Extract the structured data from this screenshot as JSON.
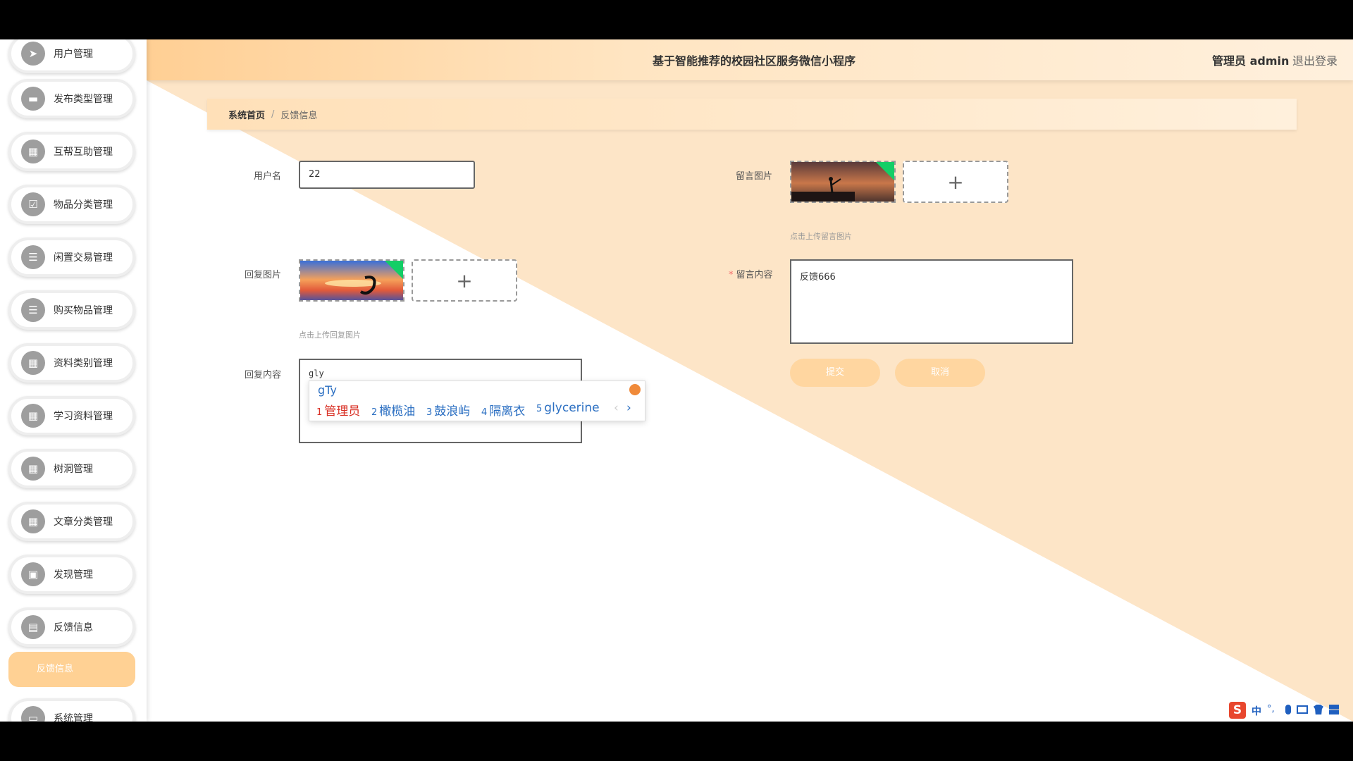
{
  "header": {
    "app_title": "基于智能推荐的校园社区服务微信小程序",
    "admin_label": "管理员 admin",
    "logout": "退出登录"
  },
  "sidebar": {
    "items": [
      {
        "label": "用户管理",
        "icon": "send-icon"
      },
      {
        "label": "发布类型管理",
        "icon": "box-icon"
      },
      {
        "label": "互帮互助管理",
        "icon": "grid-icon"
      },
      {
        "label": "物品分类管理",
        "icon": "checkbox-icon"
      },
      {
        "label": "闲置交易管理",
        "icon": "list-icon"
      },
      {
        "label": "购买物品管理",
        "icon": "list-icon"
      },
      {
        "label": "资料类别管理",
        "icon": "grid-icon"
      },
      {
        "label": "学习资料管理",
        "icon": "grid-icon"
      },
      {
        "label": "树洞管理",
        "icon": "grid-icon"
      },
      {
        "label": "文章分类管理",
        "icon": "grid-icon"
      },
      {
        "label": "发现管理",
        "icon": "clipboard-icon"
      },
      {
        "label": "反馈信息",
        "icon": "book-icon"
      },
      {
        "label": "系统管理",
        "icon": "monitor-icon"
      }
    ],
    "active_sub": "反馈信息"
  },
  "breadcrumb": {
    "home": "系统首页",
    "separator": "/",
    "current": "反馈信息"
  },
  "form": {
    "username": {
      "label": "用户名",
      "value": "22"
    },
    "reply_image": {
      "label": "回复图片",
      "hint": "点击上传回复图片"
    },
    "reply_content": {
      "label": "回复内容",
      "value": "gly"
    },
    "message_image": {
      "label": "留言图片",
      "hint": "点击上传留言图片"
    },
    "message_content": {
      "label": "留言内容",
      "required_mark": "*",
      "value": "反馈666"
    },
    "upload_plus": "+",
    "submit": "提交",
    "cancel": "取消"
  },
  "ime": {
    "composition": "gTy",
    "candidates": [
      {
        "num": "1",
        "text": "管理员"
      },
      {
        "num": "2",
        "text": "橄榄油"
      },
      {
        "num": "3",
        "text": "鼓浪屿"
      },
      {
        "num": "4",
        "text": "隔离衣"
      },
      {
        "num": "5",
        "text": "glycerine"
      }
    ],
    "prev": "‹",
    "next": "›"
  },
  "tray": {
    "lang": "中",
    "punct": "°,"
  },
  "colors": {
    "accent": "#ffd194",
    "topbar": "#ffcf94",
    "button": "#ffd6a0",
    "upload_success": "#13ce66"
  }
}
